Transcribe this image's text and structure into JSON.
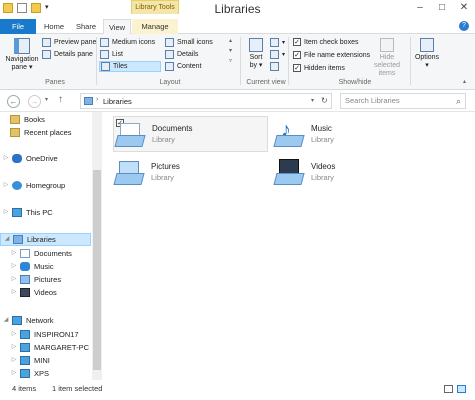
{
  "window": {
    "title": "Libraries",
    "context_tab": "Library Tools",
    "minimize": "–",
    "maximize": "□",
    "close": "✕",
    "help": "?"
  },
  "tabs": [
    "File",
    "Home",
    "Share",
    "View",
    "Manage"
  ],
  "ribbon": {
    "navigation_pane": "Navigation pane ▾",
    "preview_pane": "Preview pane",
    "details_pane": "Details pane",
    "panes_label": "Panes",
    "medium_icons": "Medium icons",
    "small_icons": "Small icons",
    "list": "List",
    "details": "Details",
    "tiles": "Tiles",
    "content": "Content",
    "layout_label": "Layout",
    "sort_by": "Sort by ▾",
    "current_view_label": "Current view",
    "item_check_boxes": "Item check boxes",
    "file_name_extensions": "File name extensions",
    "hidden_items": "Hidden items",
    "hide_selected": "Hide selected items",
    "show_hide_label": "Show/hide",
    "options": "Options ▾"
  },
  "address": {
    "path": "Libraries",
    "search_placeholder": "Search Libraries"
  },
  "sidebar": [
    {
      "label": "Books",
      "indent": 1
    },
    {
      "label": "Recent places",
      "indent": 1
    },
    {
      "label": "OneDrive",
      "indent": 0
    },
    {
      "label": "Homegroup",
      "indent": 0
    },
    {
      "label": "This PC",
      "indent": 0
    },
    {
      "label": "Libraries",
      "indent": 0,
      "selected": true
    },
    {
      "label": "Documents",
      "indent": 1
    },
    {
      "label": "Music",
      "indent": 1
    },
    {
      "label": "Pictures",
      "indent": 1
    },
    {
      "label": "Videos",
      "indent": 1
    },
    {
      "label": "Network",
      "indent": 0
    },
    {
      "label": "INSPIRON17",
      "indent": 1
    },
    {
      "label": "MARGARET-PC",
      "indent": 1
    },
    {
      "label": "MINI",
      "indent": 1
    },
    {
      "label": "XPS",
      "indent": 1
    }
  ],
  "tiles": [
    {
      "name": "Documents",
      "type": "Library"
    },
    {
      "name": "Music",
      "type": "Library"
    },
    {
      "name": "Pictures",
      "type": "Library"
    },
    {
      "name": "Videos",
      "type": "Library"
    }
  ],
  "status": {
    "items": "4 items",
    "selected": "1 item selected"
  }
}
